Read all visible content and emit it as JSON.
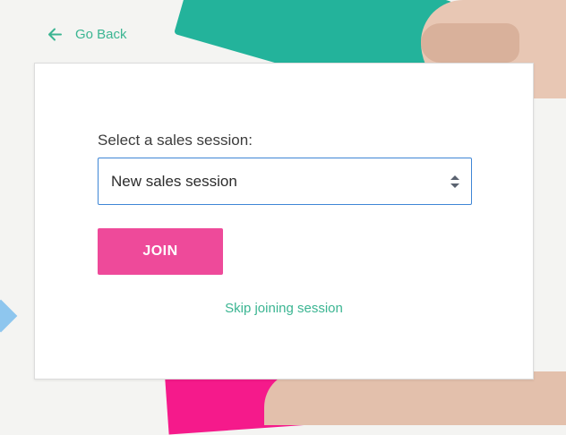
{
  "nav": {
    "back_label": "Go Back"
  },
  "form": {
    "label": "Select a sales session:",
    "selected_value": "New sales session",
    "join_label": "JOIN",
    "skip_label": "Skip joining session"
  },
  "colors": {
    "accent_green": "#3bb592",
    "button_pink": "#ee4a9a",
    "select_border": "#3f86d6"
  },
  "icons": [
    "arrow-left-icon",
    "select-arrows-icon"
  ]
}
